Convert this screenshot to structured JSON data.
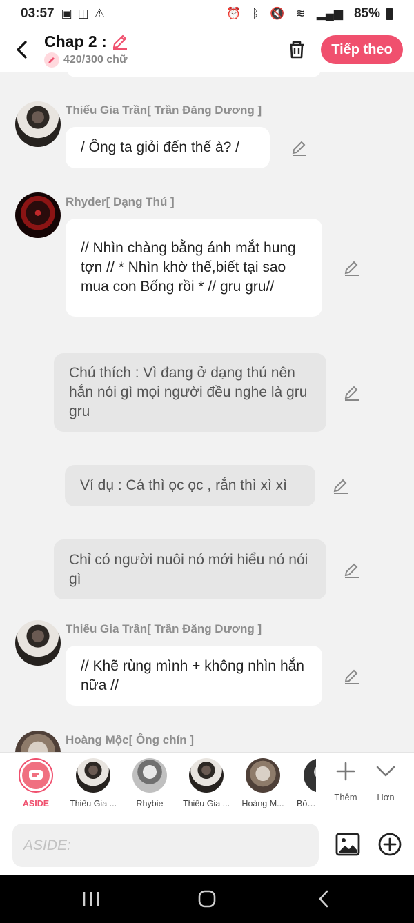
{
  "status": {
    "time": "03:57",
    "battery": "85%"
  },
  "header": {
    "title": "Chap 2 :",
    "word_count": "420/300 chữ",
    "next_label": "Tiếp theo"
  },
  "messages": [
    {
      "speaker": "Thiếu Gia Trần[ Trần Đăng Dương ]",
      "text": "/ Ông ta giỏi đến thế à? /"
    },
    {
      "speaker": "Rhyder[ Dạng Thú ]",
      "text": "// Nhìn chàng bằng ánh mắt hung tợn // * Nhìn khờ thế,biết tại sao mua con Bống rồi * // gru gru//"
    },
    {
      "text": "Chú thích : Vì đang ở dạng thú nên hắn nói gì mọi người đều nghe là gru gru"
    },
    {
      "text": "Ví dụ : Cá thì ọc ọc , rắn thì xì xì"
    },
    {
      "text": "Chỉ có người nuôi nó mới hiểu nó nói gì"
    },
    {
      "speaker": "Thiếu Gia Trần[ Trần Đăng Dương ]",
      "text": "// Khẽ rùng mình + không nhìn hắn nữa //"
    },
    {
      "speaker": "Hoàng Mộc[ Ông chín ]"
    }
  ],
  "characters": [
    {
      "label": "ASIDE"
    },
    {
      "label": "Thiếu Gia ..."
    },
    {
      "label": "Rhybie"
    },
    {
      "label": "Thiếu Gia ..."
    },
    {
      "label": "Hoàng M..."
    },
    {
      "label": "Bống"
    }
  ],
  "tools": {
    "add_label": "Thêm",
    "more_label": "Hơn"
  },
  "input": {
    "placeholder": "ASIDE:"
  },
  "colors": {
    "accent": "#f0506e",
    "background": "#f2f2f2"
  }
}
